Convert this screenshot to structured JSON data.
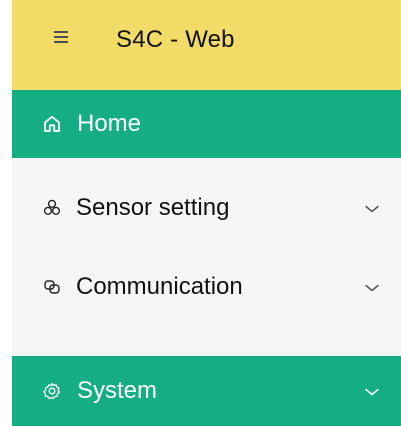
{
  "header": {
    "title": "S4C - Web",
    "menu_icon": "hamburger-icon"
  },
  "nav": {
    "home": {
      "label": "Home",
      "icon": "home-icon"
    },
    "sensor_setting": {
      "label": "Sensor setting",
      "icon": "sensor-cluster-icon",
      "expand_icon": "chevron-down-icon"
    },
    "communication": {
      "label": "Communication",
      "icon": "chat-bubbles-icon",
      "expand_icon": "chevron-down-icon"
    },
    "system": {
      "label": "System",
      "icon": "gear-icon",
      "expand_icon": "chevron-down-icon"
    }
  },
  "colors": {
    "header_bg": "#f3db67",
    "accent": "#14ad84",
    "submenu_bg": "#f6f6f6",
    "text_dark": "#111111",
    "text_light": "#ffffff"
  }
}
